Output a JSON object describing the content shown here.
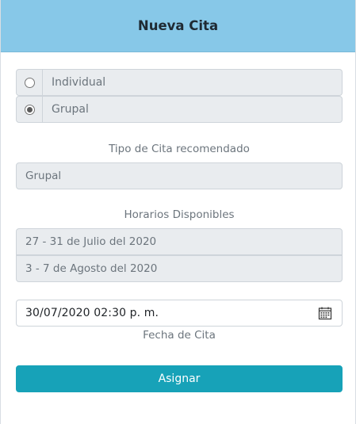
{
  "modal": {
    "title": "Nueva Cita"
  },
  "appointment_mode": {
    "options": [
      {
        "label": "Individual",
        "checked": false
      },
      {
        "label": "Grupal",
        "checked": true
      }
    ]
  },
  "recommended_type": {
    "label": "Tipo de Cita recomendado",
    "value": "Grupal"
  },
  "available_schedules": {
    "label": "Horarios Disponibles",
    "items": [
      "27 - 31 de Julio del 2020",
      "3 - 7 de Agosto del 2020"
    ]
  },
  "appointment_date": {
    "value": "30/07/2020 02:30 p. m.",
    "label": "Fecha de Cita",
    "icon": "calendar-icon"
  },
  "actions": {
    "assign_label": "Asignar",
    "assign_color": "#17a2b8"
  },
  "colors": {
    "header_background": "#87c8e8"
  }
}
